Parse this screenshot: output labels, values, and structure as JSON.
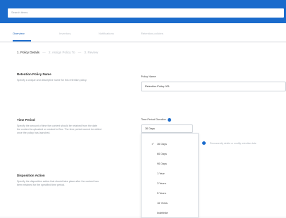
{
  "search": {
    "placeholder": "Search items"
  },
  "tabs": [
    {
      "label": "Overview",
      "active": true
    },
    {
      "label": "Inventory",
      "active": false
    },
    {
      "label": "Notifications",
      "active": false
    },
    {
      "label": "Retention policies",
      "active": false
    }
  ],
  "steps": [
    {
      "label": "1. Policy Details",
      "active": true
    },
    {
      "label": "2. Assign Policy To",
      "active": false
    },
    {
      "label": "3. Review",
      "active": false
    }
  ],
  "sections": {
    "name": {
      "title": "Retention Policy Name",
      "description": "Specify a unique and descriptive name for this retention policy.",
      "field_label": "Policy Name",
      "field_value": "Retention Policy 001"
    },
    "time": {
      "title": "Time Period",
      "description": "Specify the amount of time the content should be retained from the date the content is uploaded or created to Box. The time period cannot be edited once the policy has launched.",
      "field_label": "Time Period Duration",
      "selected": "30 Days"
    },
    "disposition": {
      "title": "Disposition Action",
      "description": "Specify the disposition action that should take place after the content has been retained for the specified time period.",
      "option_text": "Permanently delete or modify retention date"
    }
  },
  "dropdown": {
    "options": [
      {
        "label": "30 Days",
        "checked": true
      },
      {
        "label": "60 Days",
        "checked": false
      },
      {
        "label": "90 Days",
        "checked": false
      },
      {
        "label": "1 Year",
        "checked": false
      },
      {
        "label": "3 Years",
        "checked": false
      },
      {
        "label": "5 Years",
        "checked": false
      },
      {
        "label": "10 Years",
        "checked": false
      },
      {
        "label": "Indefinite",
        "checked": false
      }
    ]
  },
  "colors": {
    "brand": "#1a6bcc",
    "active_tab": "#1a5fb4"
  },
  "icons": {
    "checkmark": "check-icon",
    "info": "info-icon"
  }
}
